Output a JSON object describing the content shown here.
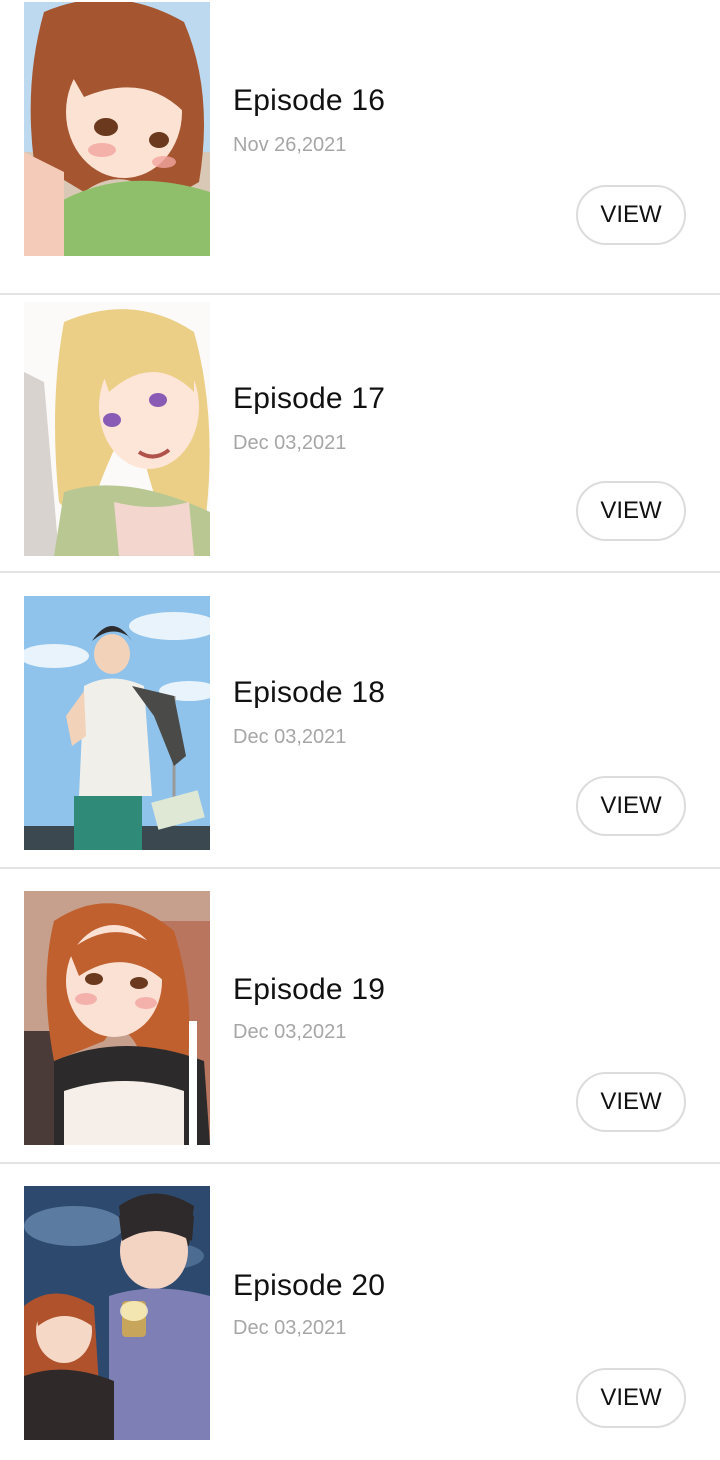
{
  "episodes": [
    {
      "title": "Episode 16",
      "date": "Nov 26,2021",
      "action": "VIEW"
    },
    {
      "title": "Episode 17",
      "date": "Dec 03,2021",
      "action": "VIEW"
    },
    {
      "title": "Episode 18",
      "date": "Dec 03,2021",
      "action": "VIEW"
    },
    {
      "title": "Episode 19",
      "date": "Dec 03,2021",
      "action": "VIEW"
    },
    {
      "title": "Episode 20",
      "date": "Dec 03,2021",
      "action": "VIEW"
    }
  ]
}
